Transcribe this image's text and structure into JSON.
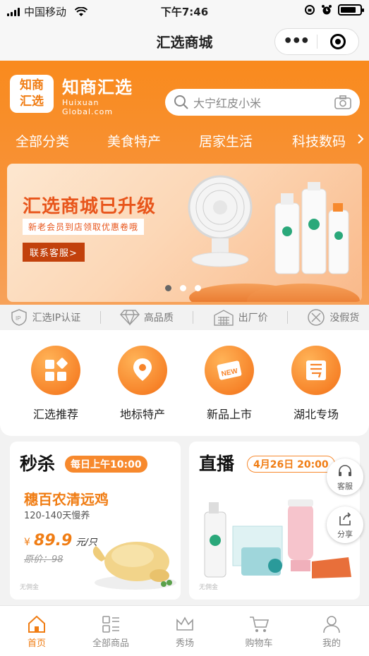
{
  "status_bar": {
    "carrier": "中国移动",
    "time": "下午7:46"
  },
  "titlebar": {
    "title": "汇选商城"
  },
  "brand": {
    "logo_line1": "知商",
    "logo_line2": "汇选",
    "name_cn": "知商汇选",
    "name_en1": "Huixuan",
    "name_en2": "Global.com"
  },
  "search": {
    "placeholder": "大宁红皮小米"
  },
  "categories": [
    "全部分类",
    "美食特产",
    "居家生活",
    "科技数码"
  ],
  "banner": {
    "headline": "汇选商城已升级",
    "subline": "新老会员到店领取优惠卷哦",
    "button": "联系客服>",
    "slides": 3,
    "active_slide": 1
  },
  "features": [
    {
      "label": "汇选IP认证",
      "icon": "ip-shield-icon"
    },
    {
      "label": "高品质",
      "icon": "diamond-icon"
    },
    {
      "label": "出厂价",
      "icon": "factory-icon"
    },
    {
      "label": "没假货",
      "icon": "no-fake-icon"
    }
  ],
  "quick_nav": [
    {
      "label": "汇选推荐",
      "icon": "grid-icon"
    },
    {
      "label": "地标特产",
      "icon": "location-pin-icon"
    },
    {
      "label": "新品上市",
      "icon": "new-tag-icon"
    },
    {
      "label": "湖北专场",
      "icon": "hubei-icon"
    }
  ],
  "flash_sale": {
    "title": "秒杀",
    "badge": "每日上午10:00",
    "product_name": "穗百农清远鸡",
    "product_desc": "120-140天慢养",
    "currency": "¥",
    "price": "89.9",
    "unit": "元/只",
    "original_price": "原价：98",
    "footer": "无佣金"
  },
  "live": {
    "title": "直播",
    "badge": "4月26日 20:00",
    "footer": "无佣金"
  },
  "float_buttons": {
    "service": "客服",
    "share": "分享"
  },
  "tabbar": [
    {
      "label": "首页",
      "icon": "home-icon",
      "active": true
    },
    {
      "label": "全部商品",
      "icon": "list-icon",
      "active": false
    },
    {
      "label": "秀场",
      "icon": "crown-icon",
      "active": false
    },
    {
      "label": "购物车",
      "icon": "cart-icon",
      "active": false
    },
    {
      "label": "我的",
      "icon": "user-icon",
      "active": false
    }
  ],
  "colors": {
    "brand_orange": "#f7892d",
    "accent_text": "#f07d14"
  }
}
